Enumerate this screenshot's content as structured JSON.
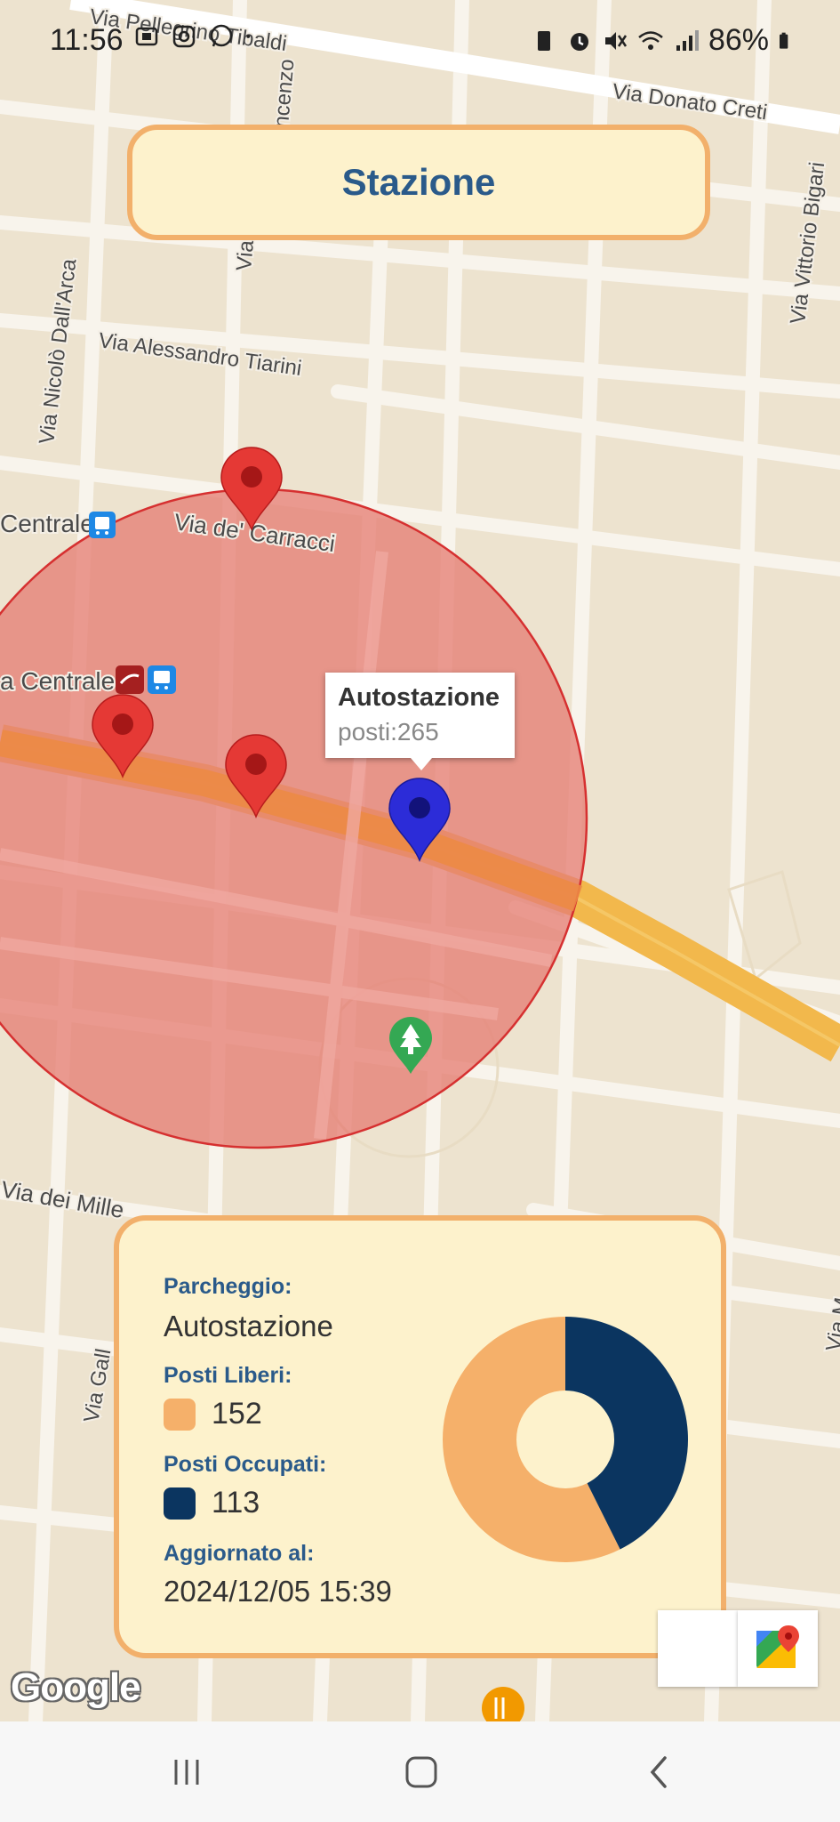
{
  "status_bar": {
    "time": "11:56",
    "battery": "86%"
  },
  "header": {
    "title": "Stazione"
  },
  "map": {
    "street_labels": [
      "Via Pellegrino Tibaldi",
      "Via Donato Creti",
      "Via Vittorio Bigari",
      "Via Nicolò Dall'Arca",
      "Via Alessandro Tiarini",
      "Via de' Carracci",
      "Via dei Mille",
      "Via Gall",
      "Via M",
      "Via",
      "Vincenzo"
    ],
    "places": [
      {
        "label": "Centrale",
        "icon": "bus-station-icon"
      },
      {
        "label": "a Centrale",
        "icon": "train-station-icon"
      }
    ],
    "info_window": {
      "title": "Autostazione",
      "subtitle": "posti:265"
    },
    "colors": {
      "circle_fill": "#e88a80",
      "circle_stroke": "#d63030",
      "marker_red": "#e53935",
      "marker_blue": "#2c2cd8",
      "road_orange": "#f0a040"
    },
    "google_logo": "Google"
  },
  "parking_card": {
    "parking_label": "Parcheggio:",
    "parking_name": "Autostazione",
    "free_label": "Posti Liberi:",
    "free_value": "152",
    "occupied_label": "Posti Occupati:",
    "occupied_value": "113",
    "updated_label": "Aggiornato al:",
    "updated_value": "2024/12/05 15:39",
    "colors": {
      "free": "#f5b06a",
      "occupied": "#0b3560"
    }
  },
  "chart_data": {
    "type": "pie",
    "donut": true,
    "categories": [
      "Posti Liberi",
      "Posti Occupati"
    ],
    "values": [
      152,
      113
    ],
    "colors": [
      "#f5b06a",
      "#0b3560"
    ]
  }
}
